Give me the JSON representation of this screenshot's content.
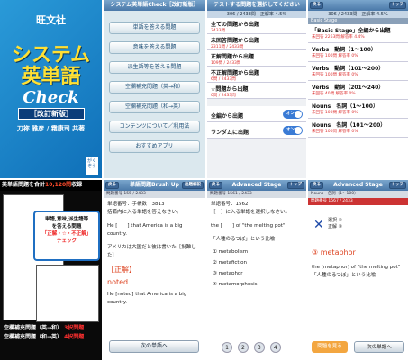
{
  "p1": {
    "publisher": "旺文社",
    "title_line1": "システム",
    "title_line2": "英単語",
    "check": "Check",
    "edition": "［改訂新版］",
    "authors": "刀祢 雅彦 / 霜康司 共著",
    "logo": "がくぞう"
  },
  "p2": {
    "header": "システム英単語Check［改訂新版］",
    "items": [
      "単語を答える問題",
      "意味を答える問題",
      "派生語等を答える問題",
      "空欄補充問題（英→和）",
      "空欄補充問題（和→英）",
      "コンテンツについて／利用法",
      "おすすめアプリ"
    ]
  },
  "p3": {
    "header": "テストする問題を選択してください",
    "sub": "306 / 2433問　正解率 4.5%",
    "items": [
      {
        "t": "全ての問題から出題",
        "s": "2433問"
      },
      {
        "t": "未回答問題から出題",
        "s": "2311問 / 2433問"
      },
      {
        "t": "正解問題から出題",
        "s": "109問 / 2433問"
      },
      {
        "t": "不正解問題から出題",
        "s": "6問 / 2433問"
      },
      {
        "t": "☆問題から出題",
        "s": "0問 / 2433問"
      }
    ],
    "toggles": [
      {
        "label": "全編から出題",
        "state": "オン"
      },
      {
        "label": "ランダムに出題",
        "state": "オン"
      }
    ]
  },
  "p4": {
    "back": "戻る",
    "header": "",
    "next": "トップ",
    "sub": "306 / 2433問　正解率 4.5%",
    "stage": "Basic Stage",
    "items": [
      {
        "t": "「Basic Stage」全編から出題",
        "s": "未回答 2263問 解答率 4.4%"
      },
      {
        "t": "Verbs　動詞（1〜100）",
        "s": "未回答 100問 解答率 0%"
      },
      {
        "t": "Verbs　動詞（101〜200）",
        "s": "未回答 100問 解答率 0%"
      },
      {
        "t": "Verbs　動詞（201〜240）",
        "s": "未回答 40問 解答率 0%"
      },
      {
        "t": "Nouns　名詞（1〜100）",
        "s": "未回答 100問 解答率 0%"
      },
      {
        "t": "Nouns　名詞（101〜200）",
        "s": "未回答 100問 解答率 0%"
      }
    ]
  },
  "p5": {
    "banner_pre": "英単語問題を合計",
    "banner_count": "10,120問",
    "banner_post": "収録",
    "callout1": "単語,意味,派生語等",
    "callout2": "を答える問題",
    "callout3": "「正解・☆・不正解」",
    "callout4": "チェック",
    "foot1": "空欄補充問題（英→和）",
    "foot1r": "3択問題",
    "foot2": "空欄補充問題（和→英）",
    "foot2r": "4択問題"
  },
  "p6": {
    "back": "戻る",
    "header": "単語問題Brush Up",
    "next": "出題解説",
    "stat": "問題番号 155 / 2433",
    "q_no": "単語番号：手帳数　3813",
    "q_intro": "括弧内に入る単語を答えなさい。",
    "q_en": "He [　　] that America is a big country.",
    "q_ja": "アメリカは大国だと彼は書いた［批難した］",
    "ans_lbl": "【正解】",
    "ans": "noted",
    "ans_en": "He [noted] that America is a big country.",
    "next_btn": "次の単語へ"
  },
  "p7": {
    "back": "戻る",
    "header": "Advanced Stage",
    "next": "トップ",
    "stat": "問題番号 1561 / 2433",
    "q_no": "単語番号：1562",
    "q_intro": "［　］に入る単語を選択しなさい。",
    "q_en": "the [　　] of \"the melting pot\"",
    "q_ja": "「人種のるつぼ」という比喩",
    "opts": [
      "① metabolism",
      "② metafiction",
      "③ metaphor",
      "④ metamorphosis"
    ],
    "nums": [
      "1",
      "2",
      "3",
      "4"
    ]
  },
  "p8": {
    "back": "戻る",
    "header": "Advanced Stage",
    "next": "トップ",
    "stat": "Nouns　名詞（1〜100）",
    "stat2": "問題番号 1567 / 2433",
    "sel": "選択 ④",
    "ok": "正解 ③",
    "ans": "③ metaphor",
    "ans_en": "the [metaphor] of \"the melting pot\"",
    "ans_ja": "「人種のるつぼ」という比喩",
    "fb": "問題を見る",
    "nb": "次の単語へ"
  }
}
